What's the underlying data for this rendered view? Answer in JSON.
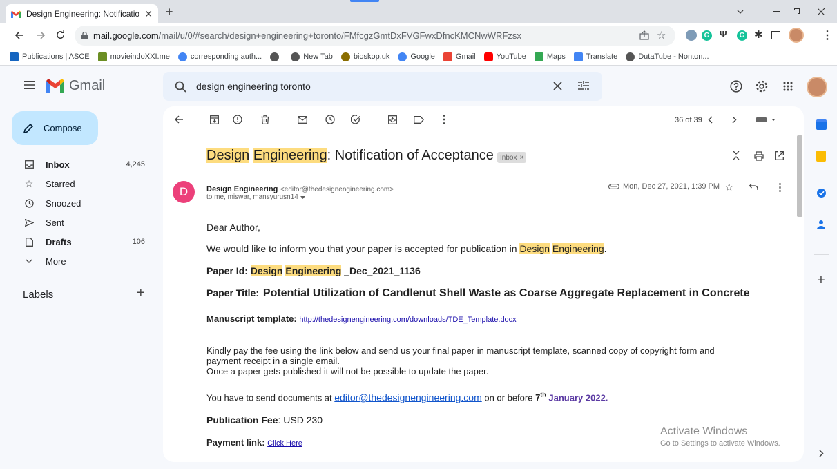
{
  "browser": {
    "tab_title": "Design Engineering: Notification",
    "url_host": "mail.google.com",
    "url_path": "/mail/u/0/#search/design+engineering+toronto/FMfcgzGmtDxFVGFwxDfncKMCNwWRFzsx",
    "bookmarks": [
      {
        "label": "Publications | ASCE",
        "color": "#1565c0"
      },
      {
        "label": "movieindoXXI.me",
        "color": "#6b8e23"
      },
      {
        "label": "corresponding auth...",
        "color": "#4285f4"
      },
      {
        "label": "",
        "color": "#555555"
      },
      {
        "label": "New Tab",
        "color": "#555555"
      },
      {
        "label": "bioskop.uk",
        "color": "#8a6d00"
      },
      {
        "label": "Google",
        "color": "#4285f4"
      },
      {
        "label": "Gmail",
        "color": "#ea4335"
      },
      {
        "label": "YouTube",
        "color": "#ff0000"
      },
      {
        "label": "Maps",
        "color": "#34a853"
      },
      {
        "label": "Translate",
        "color": "#4285f4"
      },
      {
        "label": "DutaTube - Nonton...",
        "color": "#555555"
      }
    ]
  },
  "gmail": {
    "brand": "Gmail",
    "search_value": "design engineering toronto",
    "compose_label": "Compose",
    "nav": [
      {
        "label": "Inbox",
        "count": "4,245",
        "bold": true
      },
      {
        "label": "Starred",
        "count": "",
        "bold": false
      },
      {
        "label": "Snoozed",
        "count": "",
        "bold": false
      },
      {
        "label": "Sent",
        "count": "",
        "bold": false
      },
      {
        "label": "Drafts",
        "count": "106",
        "bold": true
      },
      {
        "label": "More",
        "count": "",
        "bold": false
      }
    ],
    "labels_heading": "Labels",
    "pager": "36 of 39"
  },
  "email": {
    "subject_parts": [
      "Design",
      " ",
      "Engineering",
      ": Notification of Acceptance"
    ],
    "inbox_chip": "Inbox",
    "avatar_letter": "D",
    "sender_name": "Design Engineering",
    "sender_email": "<editor@thedesignengineering.com>",
    "recipients": "to me, miswar, mansyurusn14",
    "date": "Mon, Dec 27, 2021, 1:39 PM",
    "greeting": "Dear Author,",
    "p1_pre": "We would like to inform you that your paper is accepted for publication in ",
    "p1_h1": "Design",
    "p1_h2": "Engineering",
    "p1_post": ".",
    "paper_id_label": "Paper Id: ",
    "paper_id_h1": "Design",
    "paper_id_h2": "Engineering",
    "paper_id_post": " _Dec_2021_1136",
    "paper_title_label": "Paper Title:",
    "paper_title": "Potential Utilization of Candlenut Shell Waste as Coarse Aggregate Replacement in Concrete",
    "template_label": "Manuscript template:",
    "template_link": "http://thedesignengineering.com/downloads/TDE_Template.docx",
    "kindly_line1": "Kindly pay the fee using the link below and send us your final paper in manuscript template, scanned copy of copyright form and",
    "kindly_line2": "payment receipt in a single email.",
    "kindly_line3": "Once a paper gets published it will not be possible to update the paper.",
    "send_pre": "You have to send documents at ",
    "send_email": "editor@thedesignengineering.com",
    "send_mid": " on or before ",
    "deadline_day": "7",
    "deadline_sup": "th",
    "deadline_rest": " January 2022.",
    "fee_label": "Publication Fee",
    "fee_value": ": USD 230",
    "payment_label": "Payment link:",
    "payment_link": "Click Here"
  },
  "watermark": {
    "line1": "Activate Windows",
    "line2": "Go to Settings to activate Windows."
  }
}
